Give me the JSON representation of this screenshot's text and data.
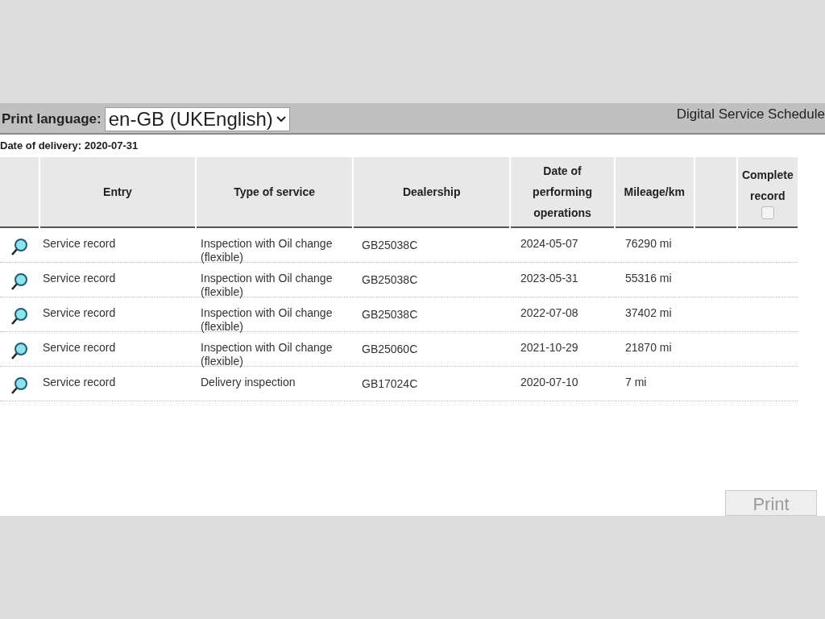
{
  "header": {
    "print_language_label": "Print language:",
    "language_select": "en-GB (UKEnglish)",
    "title": "Digital Service Schedule"
  },
  "date_of_delivery": "Date of delivery: 2020-07-31",
  "table": {
    "columns": [
      "",
      "Entry",
      "Type of service",
      "Dealership",
      "Date of performing operations",
      "Mileage/km",
      ""
    ],
    "complete_column": {
      "label": "Complete record",
      "checked": false
    },
    "rows": [
      {
        "entry": "Service record",
        "type": "Inspection with Oil change (flexible)",
        "dealership": "GB25038C",
        "date": "2024-05-07",
        "mileage": "76290 mi"
      },
      {
        "entry": "Service record",
        "type": "Inspection with Oil change (flexible)",
        "dealership": "GB25038C",
        "date": "2023-05-31",
        "mileage": "55316 mi"
      },
      {
        "entry": "Service record",
        "type": "Inspection with Oil change (flexible)",
        "dealership": "GB25038C",
        "date": "2022-07-08",
        "mileage": "37402 mi"
      },
      {
        "entry": "Service record",
        "type": "Inspection with Oil change (flexible)",
        "dealership": "GB25060C",
        "date": "2021-10-29",
        "mileage": "21870 mi"
      },
      {
        "entry": "Service record",
        "type": "Delivery inspection",
        "dealership": "GB17024C",
        "date": "2020-07-10",
        "mileage": "7 mi"
      }
    ]
  },
  "print_button": {
    "label": "Print",
    "disabled": true
  }
}
